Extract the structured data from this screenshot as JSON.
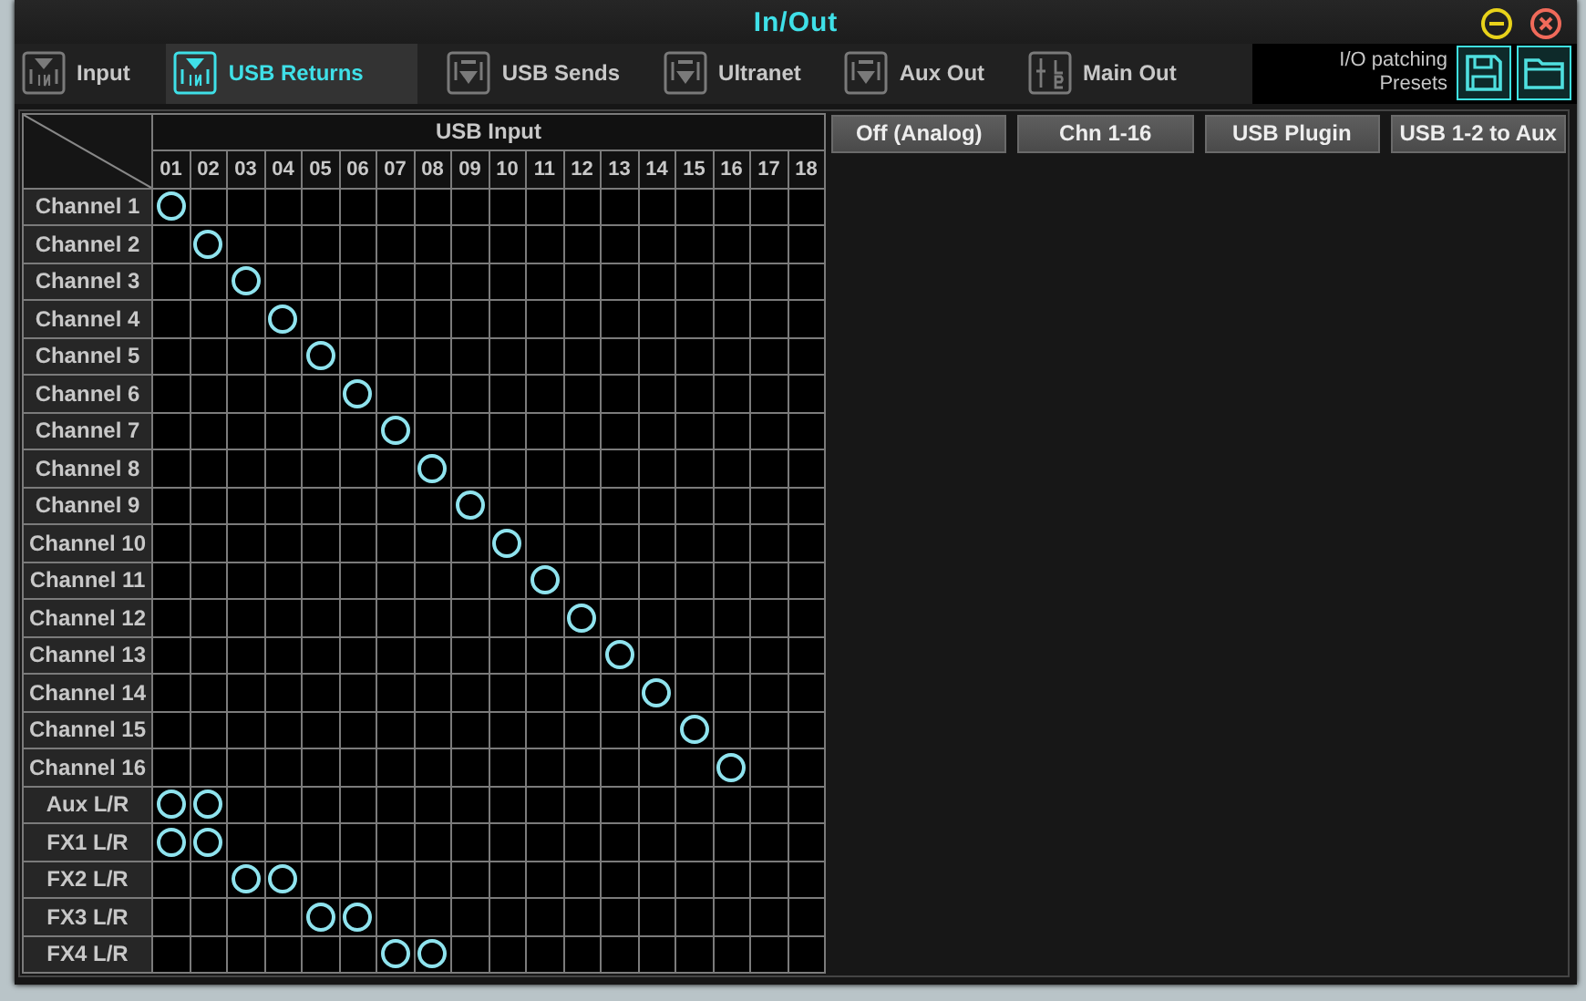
{
  "window": {
    "title": "In/Out"
  },
  "tabs": [
    {
      "label": "Input",
      "kind": "in",
      "selected": false
    },
    {
      "label": "USB Returns",
      "kind": "in",
      "selected": true
    },
    {
      "label": "USB Sends",
      "kind": "out",
      "selected": false
    },
    {
      "label": "Ultranet",
      "kind": "out",
      "selected": false
    },
    {
      "label": "Aux Out",
      "kind": "out",
      "selected": false
    },
    {
      "label": "Main Out",
      "kind": "main",
      "selected": false
    }
  ],
  "presets": {
    "label": "I/O patching Presets"
  },
  "matrix": {
    "header": "USB Input",
    "columns": [
      "01",
      "02",
      "03",
      "04",
      "05",
      "06",
      "07",
      "08",
      "09",
      "10",
      "11",
      "12",
      "13",
      "14",
      "15",
      "16",
      "17",
      "18"
    ],
    "rows": [
      {
        "label": "Channel 1",
        "patched": [
          true,
          false,
          false,
          false,
          false,
          false,
          false,
          false,
          false,
          false,
          false,
          false,
          false,
          false,
          false,
          false,
          false,
          false
        ]
      },
      {
        "label": "Channel 2",
        "patched": [
          false,
          true,
          false,
          false,
          false,
          false,
          false,
          false,
          false,
          false,
          false,
          false,
          false,
          false,
          false,
          false,
          false,
          false
        ]
      },
      {
        "label": "Channel 3",
        "patched": [
          false,
          false,
          true,
          false,
          false,
          false,
          false,
          false,
          false,
          false,
          false,
          false,
          false,
          false,
          false,
          false,
          false,
          false
        ]
      },
      {
        "label": "Channel 4",
        "patched": [
          false,
          false,
          false,
          true,
          false,
          false,
          false,
          false,
          false,
          false,
          false,
          false,
          false,
          false,
          false,
          false,
          false,
          false
        ]
      },
      {
        "label": "Channel 5",
        "patched": [
          false,
          false,
          false,
          false,
          true,
          false,
          false,
          false,
          false,
          false,
          false,
          false,
          false,
          false,
          false,
          false,
          false,
          false
        ]
      },
      {
        "label": "Channel 6",
        "patched": [
          false,
          false,
          false,
          false,
          false,
          true,
          false,
          false,
          false,
          false,
          false,
          false,
          false,
          false,
          false,
          false,
          false,
          false
        ]
      },
      {
        "label": "Channel 7",
        "patched": [
          false,
          false,
          false,
          false,
          false,
          false,
          true,
          false,
          false,
          false,
          false,
          false,
          false,
          false,
          false,
          false,
          false,
          false
        ]
      },
      {
        "label": "Channel 8",
        "patched": [
          false,
          false,
          false,
          false,
          false,
          false,
          false,
          true,
          false,
          false,
          false,
          false,
          false,
          false,
          false,
          false,
          false,
          false
        ]
      },
      {
        "label": "Channel 9",
        "patched": [
          false,
          false,
          false,
          false,
          false,
          false,
          false,
          false,
          true,
          false,
          false,
          false,
          false,
          false,
          false,
          false,
          false,
          false
        ]
      },
      {
        "label": "Channel 10",
        "patched": [
          false,
          false,
          false,
          false,
          false,
          false,
          false,
          false,
          false,
          true,
          false,
          false,
          false,
          false,
          false,
          false,
          false,
          false
        ]
      },
      {
        "label": "Channel 11",
        "patched": [
          false,
          false,
          false,
          false,
          false,
          false,
          false,
          false,
          false,
          false,
          true,
          false,
          false,
          false,
          false,
          false,
          false,
          false
        ]
      },
      {
        "label": "Channel 12",
        "patched": [
          false,
          false,
          false,
          false,
          false,
          false,
          false,
          false,
          false,
          false,
          false,
          true,
          false,
          false,
          false,
          false,
          false,
          false
        ]
      },
      {
        "label": "Channel 13",
        "patched": [
          false,
          false,
          false,
          false,
          false,
          false,
          false,
          false,
          false,
          false,
          false,
          false,
          true,
          false,
          false,
          false,
          false,
          false
        ]
      },
      {
        "label": "Channel 14",
        "patched": [
          false,
          false,
          false,
          false,
          false,
          false,
          false,
          false,
          false,
          false,
          false,
          false,
          false,
          true,
          false,
          false,
          false,
          false
        ]
      },
      {
        "label": "Channel 15",
        "patched": [
          false,
          false,
          false,
          false,
          false,
          false,
          false,
          false,
          false,
          false,
          false,
          false,
          false,
          false,
          true,
          false,
          false,
          false
        ]
      },
      {
        "label": "Channel 16",
        "patched": [
          false,
          false,
          false,
          false,
          false,
          false,
          false,
          false,
          false,
          false,
          false,
          false,
          false,
          false,
          false,
          true,
          false,
          false
        ]
      },
      {
        "label": "Aux L/R",
        "patched": [
          true,
          true,
          false,
          false,
          false,
          false,
          false,
          false,
          false,
          false,
          false,
          false,
          false,
          false,
          false,
          false,
          false,
          false
        ]
      },
      {
        "label": "FX1 L/R",
        "patched": [
          true,
          true,
          false,
          false,
          false,
          false,
          false,
          false,
          false,
          false,
          false,
          false,
          false,
          false,
          false,
          false,
          false,
          false
        ]
      },
      {
        "label": "FX2 L/R",
        "patched": [
          false,
          false,
          true,
          true,
          false,
          false,
          false,
          false,
          false,
          false,
          false,
          false,
          false,
          false,
          false,
          false,
          false,
          false
        ]
      },
      {
        "label": "FX3 L/R",
        "patched": [
          false,
          false,
          false,
          false,
          true,
          true,
          false,
          false,
          false,
          false,
          false,
          false,
          false,
          false,
          false,
          false,
          false,
          false
        ]
      },
      {
        "label": "FX4 L/R",
        "patched": [
          false,
          false,
          false,
          false,
          false,
          false,
          true,
          true,
          false,
          false,
          false,
          false,
          false,
          false,
          false,
          false,
          false,
          false
        ]
      }
    ]
  },
  "preset_buttons": [
    "Off (Analog)",
    "Chn 1-16",
    "USB Plugin",
    "USB 1-2 to Aux"
  ]
}
